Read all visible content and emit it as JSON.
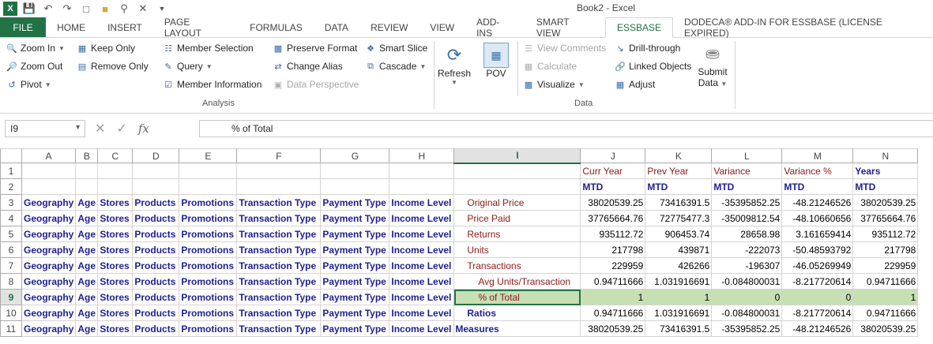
{
  "window": {
    "title": "Book2 - Excel"
  },
  "qat_icons": [
    "excel-logo-icon",
    "save-icon",
    "undo-icon",
    "redo-icon",
    "new-document-icon",
    "open-folder-icon",
    "print-preview-icon",
    "close-x-icon",
    "customize-qat-icon"
  ],
  "tabs": [
    "FILE",
    "HOME",
    "INSERT",
    "PAGE LAYOUT",
    "FORMULAS",
    "DATA",
    "REVIEW",
    "VIEW",
    "ADD-INS",
    "SMART VIEW",
    "ESSBASE",
    "DODECA® ADD-IN FOR ESSBASE (LICENSE EXPIRED)"
  ],
  "active_tab": "ESSBASE",
  "ribbon": {
    "analysis": {
      "label": "Analysis",
      "zoom_in": "Zoom In",
      "zoom_out": "Zoom Out",
      "pivot": "Pivot",
      "keep_only": "Keep Only",
      "remove_only": "Remove Only",
      "member_selection": "Member Selection",
      "query": "Query",
      "member_information": "Member Information",
      "preserve_format": "Preserve Format",
      "change_alias": "Change Alias",
      "data_perspective": "Data Perspective",
      "smart_slice": "Smart Slice",
      "cascade": "Cascade"
    },
    "data": {
      "label": "Data",
      "refresh": "Refresh",
      "pov": "POV",
      "view_comments": "View Comments",
      "calculate": "Calculate",
      "visualize": "Visualize",
      "drill_through": "Drill-through",
      "linked_objects": "Linked Objects",
      "adjust": "Adjust",
      "submit_data_1": "Submit",
      "submit_data_2": "Data"
    }
  },
  "formula_bar": {
    "name_box": "I9",
    "content": "% of Total"
  },
  "columns": [
    "A",
    "B",
    "C",
    "D",
    "E",
    "F",
    "G",
    "H",
    "I",
    "J",
    "K",
    "L",
    "M",
    "N"
  ],
  "selected_column": "I",
  "selected_row": 9,
  "rows": [
    {
      "n": "1",
      "cells": [
        "",
        "",
        "",
        "",
        "",
        "",
        "",
        "",
        "",
        "Curr Year",
        "Prev Year",
        "Variance",
        "Variance %",
        "Years"
      ]
    },
    {
      "n": "2",
      "cells": [
        "",
        "",
        "",
        "",
        "",
        "",
        "",
        "",
        "",
        "MTD",
        "MTD",
        "MTD",
        "MTD",
        "MTD"
      ]
    },
    {
      "n": "3",
      "cells": [
        "Geography",
        "Age",
        "Stores",
        "Products",
        "Promotions",
        "Transaction Type",
        "Payment Type",
        "Income Level",
        "Original Price",
        "38020539.25",
        "73416391.5",
        "-35395852.25",
        "-48.21246526",
        "38020539.25"
      ]
    },
    {
      "n": "4",
      "cells": [
        "Geography",
        "Age",
        "Stores",
        "Products",
        "Promotions",
        "Transaction Type",
        "Payment Type",
        "Income Level",
        "Price Paid",
        "37765664.76",
        "72775477.3",
        "-35009812.54",
        "-48.10660656",
        "37765664.76"
      ]
    },
    {
      "n": "5",
      "cells": [
        "Geography",
        "Age",
        "Stores",
        "Products",
        "Promotions",
        "Transaction Type",
        "Payment Type",
        "Income Level",
        "Returns",
        "935112.72",
        "906453.74",
        "28658.98",
        "3.161659414",
        "935112.72"
      ]
    },
    {
      "n": "6",
      "cells": [
        "Geography",
        "Age",
        "Stores",
        "Products",
        "Promotions",
        "Transaction Type",
        "Payment Type",
        "Income Level",
        "Units",
        "217798",
        "439871",
        "-222073",
        "-50.48593792",
        "217798"
      ]
    },
    {
      "n": "7",
      "cells": [
        "Geography",
        "Age",
        "Stores",
        "Products",
        "Promotions",
        "Transaction Type",
        "Payment Type",
        "Income Level",
        "Transactions",
        "229959",
        "426266",
        "-196307",
        "-46.05269949",
        "229959"
      ]
    },
    {
      "n": "8",
      "cells": [
        "Geography",
        "Age",
        "Stores",
        "Products",
        "Promotions",
        "Transaction Type",
        "Payment Type",
        "Income Level",
        "Avg Units/Transaction",
        "0.94711666",
        "1.031916691",
        "-0.084800031",
        "-8.217720614",
        "0.94711666"
      ]
    },
    {
      "n": "9",
      "cells": [
        "Geography",
        "Age",
        "Stores",
        "Products",
        "Promotions",
        "Transaction Type",
        "Payment Type",
        "Income Level",
        "% of Total",
        "1",
        "1",
        "0",
        "0",
        "1"
      ]
    },
    {
      "n": "10",
      "cells": [
        "Geography",
        "Age",
        "Stores",
        "Products",
        "Promotions",
        "Transaction Type",
        "Payment Type",
        "Income Level",
        "Ratios",
        "0.94711666",
        "1.031916691",
        "-0.084800031",
        "-8.217720614",
        "0.94711666"
      ]
    },
    {
      "n": "11",
      "cells": [
        "Geography",
        "Age",
        "Stores",
        "Products",
        "Promotions",
        "Transaction Type",
        "Payment Type",
        "Income Level",
        "Measures",
        "38020539.25",
        "73416391.5",
        "-35395852.25",
        "-48.21246526",
        "38020539.25"
      ]
    }
  ],
  "colors": {
    "excel_green": "#217346",
    "dimension_blue": "#1f1f8f",
    "member_red": "#8b1a1a",
    "highlight_green": "#c6e0b4"
  }
}
